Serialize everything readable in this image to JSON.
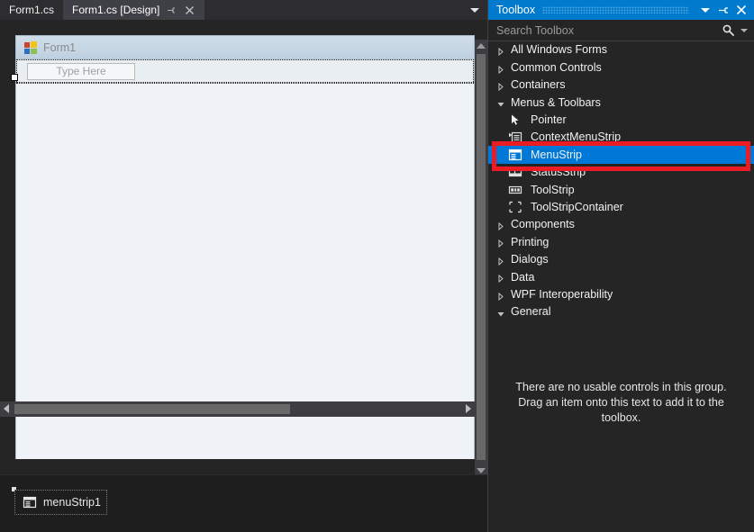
{
  "editor": {
    "tabs": [
      {
        "label": "Form1.cs",
        "active": false
      },
      {
        "label": "Form1.cs [Design]",
        "active": true
      }
    ],
    "tab_pin_glyph": "⍄",
    "tab_close_glyph": "✕",
    "overflow_icon": "chevron-down-icon"
  },
  "designer": {
    "form_title": "Form1",
    "menustrip_placeholder": "Type Here",
    "tray_item_label": "menuStrip1"
  },
  "toolbox": {
    "title": "Toolbox",
    "search_placeholder": "Search Toolbox",
    "search_value": "",
    "header_buttons": [
      {
        "name": "toolbox-dropdown-button",
        "glyph": "caret"
      },
      {
        "name": "toolbox-pin-button",
        "glyph": "⍄"
      },
      {
        "name": "toolbox-close-button",
        "glyph": "✕"
      }
    ],
    "tree": [
      {
        "kind": "category",
        "label": "All Windows Forms",
        "expanded": false
      },
      {
        "kind": "category",
        "label": "Common Controls",
        "expanded": false
      },
      {
        "kind": "category",
        "label": "Containers",
        "expanded": false
      },
      {
        "kind": "category",
        "label": "Menus & Toolbars",
        "expanded": true
      },
      {
        "kind": "item",
        "label": "Pointer",
        "icon": "pointer-icon",
        "selected": false
      },
      {
        "kind": "item",
        "label": "ContextMenuStrip",
        "icon": "contextmenustrip-icon",
        "selected": false
      },
      {
        "kind": "item",
        "label": "MenuStrip",
        "icon": "menustrip-icon",
        "selected": true
      },
      {
        "kind": "item",
        "label": "StatusStrip",
        "icon": "statusstrip-icon",
        "selected": false
      },
      {
        "kind": "item",
        "label": "ToolStrip",
        "icon": "toolstrip-icon",
        "selected": false
      },
      {
        "kind": "item",
        "label": "ToolStripContainer",
        "icon": "toolstripcontainer-icon",
        "selected": false
      },
      {
        "kind": "category",
        "label": "Components",
        "expanded": false
      },
      {
        "kind": "category",
        "label": "Printing",
        "expanded": false
      },
      {
        "kind": "category",
        "label": "Dialogs",
        "expanded": false
      },
      {
        "kind": "category",
        "label": "Data",
        "expanded": false
      },
      {
        "kind": "category",
        "label": "WPF Interoperability",
        "expanded": false
      },
      {
        "kind": "category",
        "label": "General",
        "expanded": true
      }
    ],
    "empty_group_message": "There are no usable controls in this group. Drag an item onto this text to add it to the toolbox."
  },
  "annotation": {
    "color": "#ed1c24",
    "target": "MenuStrip"
  },
  "colors": {
    "accent": "#007acc",
    "selection": "#0078d7",
    "panel_bg": "#252526",
    "editor_bg": "#1e1e1e",
    "tab_active": "#3f3f46",
    "annotation_red": "#ed1c24"
  }
}
